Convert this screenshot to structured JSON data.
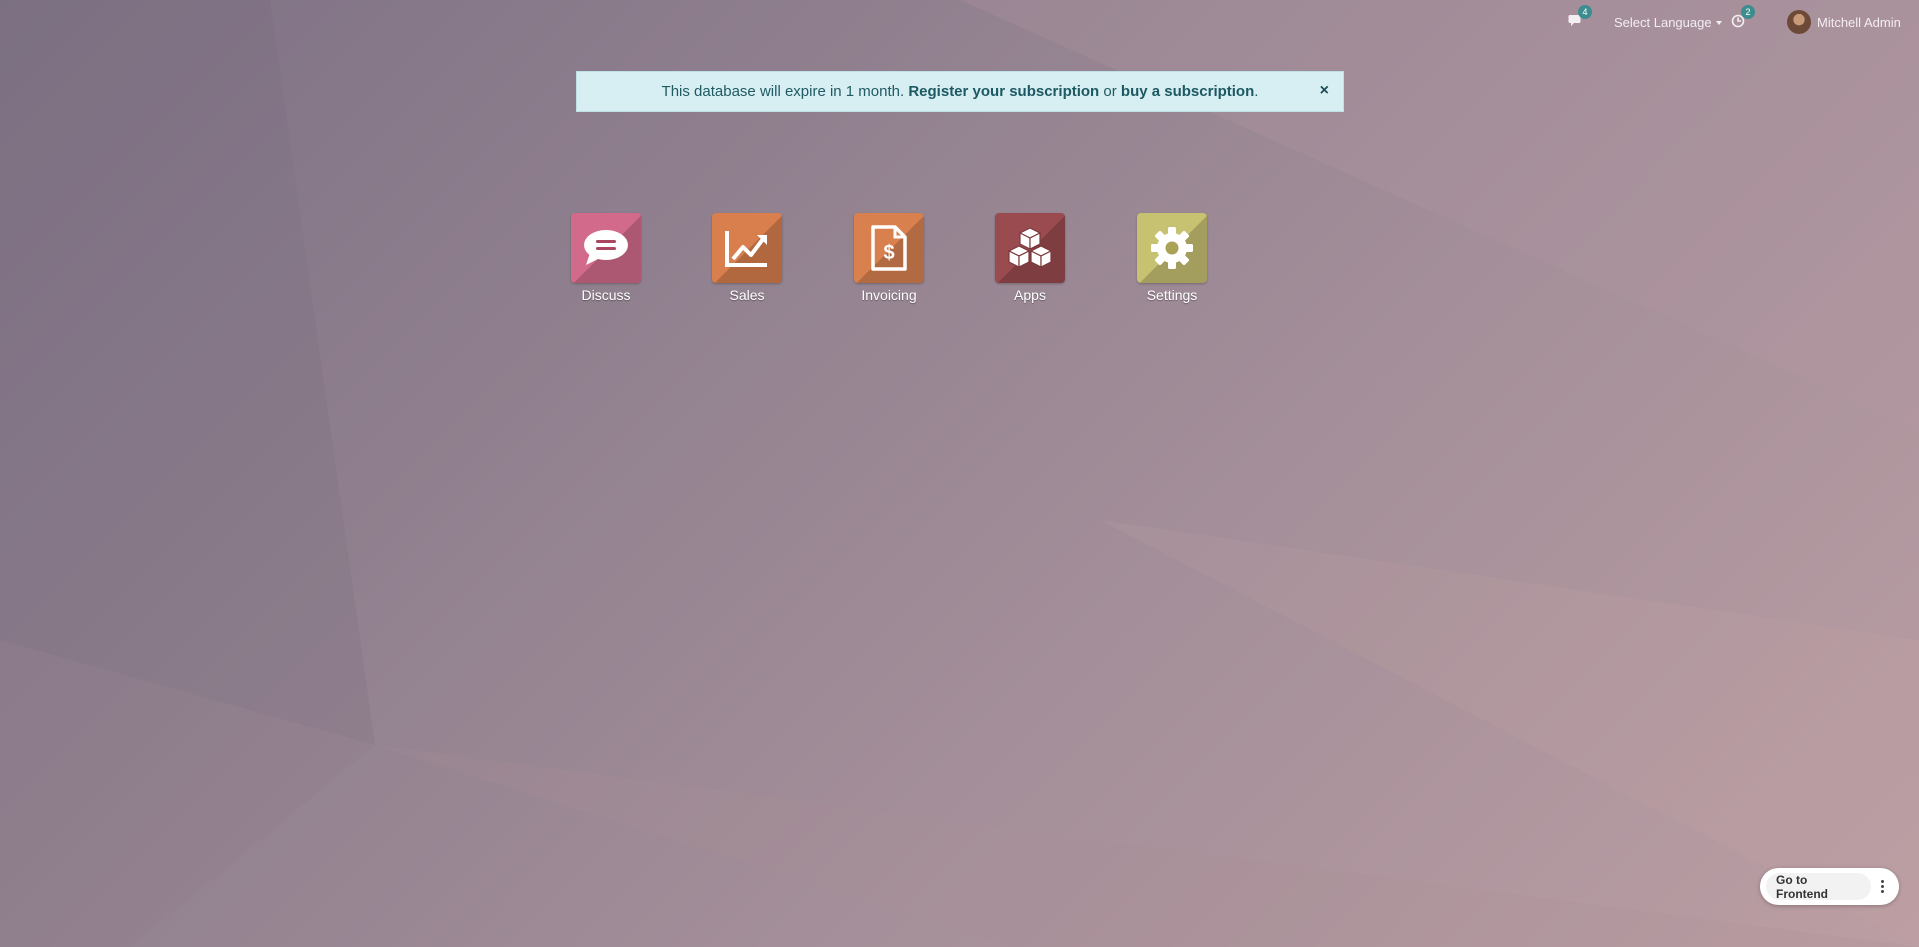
{
  "topbar": {
    "messages_count": "4",
    "language_label": "Select Language",
    "activities_count": "2",
    "user_name": "Mitchell Admin"
  },
  "banner": {
    "text_before": "This database will expire in 1 month.",
    "register_link": "Register your subscription",
    "or_text": "or",
    "buy_link": "buy a subscription",
    "end_text": ".",
    "close": "×"
  },
  "apps": [
    {
      "label": "Discuss",
      "icon": "chat-bubble-icon",
      "color": "#d26b8b"
    },
    {
      "label": "Sales",
      "icon": "trend-chart-icon",
      "color": "#d87f4d"
    },
    {
      "label": "Invoicing",
      "icon": "invoice-dollar-icon",
      "color": "#d8814f"
    },
    {
      "label": "Apps",
      "icon": "cubes-icon",
      "color": "#9a4b4f"
    },
    {
      "label": "Settings",
      "icon": "gear-icon",
      "color": "#c7c172"
    }
  ],
  "frontend": {
    "label": "Go to Frontend"
  }
}
